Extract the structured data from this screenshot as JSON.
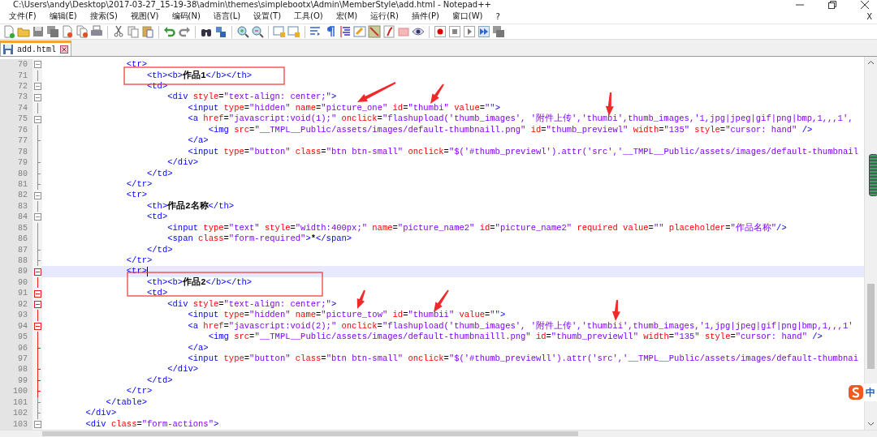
{
  "window": {
    "title": "C:\\Users\\andy\\Desktop\\2017-03-27_15-19-38\\admin\\themes\\simplebootx\\Admin\\MemberStyle\\add.html - Notepad++"
  },
  "menu": [
    "文件(F)",
    "编辑(E)",
    "搜索(S)",
    "视图(V)",
    "编码(N)",
    "语言(L)",
    "设置(T)",
    "工具(O)",
    "宏(M)",
    "运行(R)",
    "插件(P)",
    "窗口(W)",
    "?"
  ],
  "close_document": "X",
  "tabs": [
    {
      "label": "add.html",
      "selected": true
    }
  ],
  "lines": [
    {
      "number": "70",
      "kind": "fold-start",
      "fold_active": false,
      "current": false,
      "tokens": [
        {
          "kind": "tag",
          "text": "                <tr>"
        }
      ]
    },
    {
      "number": "71",
      "kind": "fold-body",
      "fold_active": false,
      "current": false,
      "tokens": [
        {
          "kind": "tag",
          "text": "                    <th><b>"
        },
        {
          "kind": "text",
          "text": "作品1"
        },
        {
          "kind": "tag",
          "text": "</b></th>"
        }
      ]
    },
    {
      "number": "72",
      "kind": "fold-start",
      "fold_active": false,
      "current": false,
      "tokens": [
        {
          "kind": "tag",
          "text": "                    <td>"
        }
      ]
    },
    {
      "number": "73",
      "kind": "fold-start",
      "fold_active": false,
      "current": false,
      "tokens": [
        {
          "kind": "tag",
          "text": "                        <div"
        },
        {
          "kind": "attr",
          "text": " style"
        },
        {
          "kind": "op",
          "text": "="
        },
        {
          "kind": "str",
          "text": "\"text-align: center;\""
        },
        {
          "kind": "tag",
          "text": ">"
        }
      ]
    },
    {
      "number": "74",
      "kind": "fold-body",
      "fold_active": false,
      "current": false,
      "tokens": [
        {
          "kind": "tag",
          "text": "                            <input"
        },
        {
          "kind": "attr",
          "text": " type"
        },
        {
          "kind": "op",
          "text": "="
        },
        {
          "kind": "str",
          "text": "\"hidden\""
        },
        {
          "kind": "attr",
          "text": " name"
        },
        {
          "kind": "op",
          "text": "="
        },
        {
          "kind": "str",
          "text": "\"picture_one\""
        },
        {
          "kind": "attr",
          "text": " id"
        },
        {
          "kind": "op",
          "text": "="
        },
        {
          "kind": "str",
          "text": "\"thumbi\""
        },
        {
          "kind": "attr",
          "text": " value"
        },
        {
          "kind": "op",
          "text": "="
        },
        {
          "kind": "str",
          "text": "\"\""
        },
        {
          "kind": "tag",
          "text": ">"
        }
      ]
    },
    {
      "number": "75",
      "kind": "fold-start",
      "fold_active": false,
      "current": false,
      "tokens": [
        {
          "kind": "tag",
          "text": "                            <a"
        },
        {
          "kind": "attr",
          "text": " href"
        },
        {
          "kind": "op",
          "text": "="
        },
        {
          "kind": "str",
          "text": "\"javascript:void(1);\""
        },
        {
          "kind": "attr",
          "text": " onclick"
        },
        {
          "kind": "op",
          "text": "="
        },
        {
          "kind": "str",
          "text": "\"flashupload('thumb_images', '附件上传','thumbi',thumb_images,'1,jpg|jpeg|gif|png|bmp,1,,,1',"
        }
      ]
    },
    {
      "number": "76",
      "kind": "fold-body",
      "fold_active": false,
      "current": false,
      "tokens": [
        {
          "kind": "tag",
          "text": "                                <img"
        },
        {
          "kind": "attr",
          "text": " src"
        },
        {
          "kind": "op",
          "text": "="
        },
        {
          "kind": "str",
          "text": "\"__TMPL__Public/assets/images/default-thumbnaill.png\""
        },
        {
          "kind": "attr",
          "text": " id"
        },
        {
          "kind": "op",
          "text": "="
        },
        {
          "kind": "str",
          "text": "\"thumb_previewl\""
        },
        {
          "kind": "attr",
          "text": " width"
        },
        {
          "kind": "op",
          "text": "="
        },
        {
          "kind": "str",
          "text": "\"135\""
        },
        {
          "kind": "attr",
          "text": " style"
        },
        {
          "kind": "op",
          "text": "="
        },
        {
          "kind": "str",
          "text": "\"cursor: hand\""
        },
        {
          "kind": "tag",
          "text": " />"
        }
      ]
    },
    {
      "number": "77",
      "kind": "fold-end",
      "fold_active": false,
      "current": false,
      "tokens": [
        {
          "kind": "tag",
          "text": "                            </a>"
        }
      ]
    },
    {
      "number": "78",
      "kind": "fold-body",
      "fold_active": false,
      "current": false,
      "tokens": [
        {
          "kind": "tag",
          "text": "                            <input"
        },
        {
          "kind": "attr",
          "text": " type"
        },
        {
          "kind": "op",
          "text": "="
        },
        {
          "kind": "str",
          "text": "\"button\""
        },
        {
          "kind": "attr",
          "text": " class"
        },
        {
          "kind": "op",
          "text": "="
        },
        {
          "kind": "str",
          "text": "\"btn btn-small\""
        },
        {
          "kind": "attr",
          "text": " onclick"
        },
        {
          "kind": "op",
          "text": "="
        },
        {
          "kind": "str",
          "text": "\"$('#thumb_previewl').attr('src','__TMPL__Public/assets/images/default-thumbnail"
        }
      ]
    },
    {
      "number": "79",
      "kind": "fold-end",
      "fold_active": false,
      "current": false,
      "tokens": [
        {
          "kind": "tag",
          "text": "                        </div>"
        }
      ]
    },
    {
      "number": "80",
      "kind": "fold-end",
      "fold_active": false,
      "current": false,
      "tokens": [
        {
          "kind": "tag",
          "text": "                    </td>"
        }
      ]
    },
    {
      "number": "81",
      "kind": "fold-end",
      "fold_active": false,
      "current": false,
      "tokens": [
        {
          "kind": "tag",
          "text": "                </tr>"
        }
      ]
    },
    {
      "number": "82",
      "kind": "fold-start",
      "fold_active": false,
      "current": false,
      "tokens": [
        {
          "kind": "tag",
          "text": "                <tr>"
        }
      ]
    },
    {
      "number": "83",
      "kind": "fold-body",
      "fold_active": false,
      "current": false,
      "tokens": [
        {
          "kind": "tag",
          "text": "                    <th>"
        },
        {
          "kind": "text",
          "text": "作品2名称"
        },
        {
          "kind": "tag",
          "text": "</th>"
        }
      ]
    },
    {
      "number": "84",
      "kind": "fold-start",
      "fold_active": false,
      "current": false,
      "tokens": [
        {
          "kind": "tag",
          "text": "                    <td>"
        }
      ]
    },
    {
      "number": "85",
      "kind": "fold-body",
      "fold_active": false,
      "current": false,
      "tokens": [
        {
          "kind": "tag",
          "text": "                        <input"
        },
        {
          "kind": "attr",
          "text": " type"
        },
        {
          "kind": "op",
          "text": "="
        },
        {
          "kind": "str",
          "text": "\"text\""
        },
        {
          "kind": "attr",
          "text": " style"
        },
        {
          "kind": "op",
          "text": "="
        },
        {
          "kind": "str",
          "text": "\"width:400px;\""
        },
        {
          "kind": "attr",
          "text": " name"
        },
        {
          "kind": "op",
          "text": "="
        },
        {
          "kind": "str",
          "text": "\"picture_name2\""
        },
        {
          "kind": "attr",
          "text": " id"
        },
        {
          "kind": "op",
          "text": "="
        },
        {
          "kind": "str",
          "text": "\"picture_name2\""
        },
        {
          "kind": "attr",
          "text": " required value"
        },
        {
          "kind": "op",
          "text": "="
        },
        {
          "kind": "str",
          "text": "\"\""
        },
        {
          "kind": "attr",
          "text": " placeholder"
        },
        {
          "kind": "op",
          "text": "="
        },
        {
          "kind": "str",
          "text": "\"作品名称\""
        },
        {
          "kind": "tag",
          "text": "/>"
        }
      ]
    },
    {
      "number": "86",
      "kind": "fold-body",
      "fold_active": false,
      "current": false,
      "tokens": [
        {
          "kind": "tag",
          "text": "                        <span"
        },
        {
          "kind": "attr",
          "text": " class"
        },
        {
          "kind": "op",
          "text": "="
        },
        {
          "kind": "str",
          "text": "\"form-required\""
        },
        {
          "kind": "tag",
          "text": ">"
        },
        {
          "kind": "text",
          "text": "*"
        },
        {
          "kind": "tag",
          "text": "</span>"
        }
      ]
    },
    {
      "number": "87",
      "kind": "fold-end",
      "fold_active": false,
      "current": false,
      "tokens": [
        {
          "kind": "tag",
          "text": "                    </td>"
        }
      ]
    },
    {
      "number": "88",
      "kind": "fold-end",
      "fold_active": false,
      "current": false,
      "tokens": [
        {
          "kind": "tag",
          "text": "                </tr>"
        }
      ]
    },
    {
      "number": "89",
      "kind": "fold-start",
      "fold_active": true,
      "current": true,
      "tokens": [
        {
          "kind": "tag",
          "text": "                <tr>"
        }
      ]
    },
    {
      "number": "90",
      "kind": "fold-body",
      "fold_active": true,
      "current": false,
      "tokens": [
        {
          "kind": "tag",
          "text": "                    <th><b>"
        },
        {
          "kind": "text",
          "text": "作品2"
        },
        {
          "kind": "tag",
          "text": "</b></th>"
        }
      ]
    },
    {
      "number": "91",
      "kind": "fold-start",
      "fold_active": true,
      "current": false,
      "tokens": [
        {
          "kind": "tag",
          "text": "                    <td>"
        }
      ]
    },
    {
      "number": "92",
      "kind": "fold-start",
      "fold_active": true,
      "current": false,
      "tokens": [
        {
          "kind": "tag",
          "text": "                        <div"
        },
        {
          "kind": "attr",
          "text": " style"
        },
        {
          "kind": "op",
          "text": "="
        },
        {
          "kind": "str",
          "text": "\"text-align: center;\""
        },
        {
          "kind": "tag",
          "text": ">"
        }
      ]
    },
    {
      "number": "93",
      "kind": "fold-body",
      "fold_active": true,
      "current": false,
      "tokens": [
        {
          "kind": "tag",
          "text": "                            <input"
        },
        {
          "kind": "attr",
          "text": " type"
        },
        {
          "kind": "op",
          "text": "="
        },
        {
          "kind": "str",
          "text": "\"hidden\""
        },
        {
          "kind": "attr",
          "text": " name"
        },
        {
          "kind": "op",
          "text": "="
        },
        {
          "kind": "str",
          "text": "\"picture_tow\""
        },
        {
          "kind": "attr",
          "text": " id"
        },
        {
          "kind": "op",
          "text": "="
        },
        {
          "kind": "str",
          "text": "\"thumbii\""
        },
        {
          "kind": "attr",
          "text": " value"
        },
        {
          "kind": "op",
          "text": "="
        },
        {
          "kind": "str",
          "text": "\"\""
        },
        {
          "kind": "tag",
          "text": ">"
        }
      ]
    },
    {
      "number": "94",
      "kind": "fold-start",
      "fold_active": true,
      "current": false,
      "tokens": [
        {
          "kind": "tag",
          "text": "                            <a"
        },
        {
          "kind": "attr",
          "text": " href"
        },
        {
          "kind": "op",
          "text": "="
        },
        {
          "kind": "str",
          "text": "\"javascript:void(2);\""
        },
        {
          "kind": "attr",
          "text": " onclick"
        },
        {
          "kind": "op",
          "text": "="
        },
        {
          "kind": "str",
          "text": "\"flashupload('thumb_images', '附件上传','thumbii',thumb_images,'1,jpg|jpeg|gif|png|bmp,1,,,1'"
        }
      ]
    },
    {
      "number": "95",
      "kind": "fold-body",
      "fold_active": true,
      "current": false,
      "tokens": [
        {
          "kind": "tag",
          "text": "                                <img"
        },
        {
          "kind": "attr",
          "text": " src"
        },
        {
          "kind": "op",
          "text": "="
        },
        {
          "kind": "str",
          "text": "\"__TMPL__Public/assets/images/default-thumbnailll.png\""
        },
        {
          "kind": "attr",
          "text": " id"
        },
        {
          "kind": "op",
          "text": "="
        },
        {
          "kind": "str",
          "text": "\"thumb_previewll\""
        },
        {
          "kind": "attr",
          "text": " width"
        },
        {
          "kind": "op",
          "text": "="
        },
        {
          "kind": "str",
          "text": "\"135\""
        },
        {
          "kind": "attr",
          "text": " style"
        },
        {
          "kind": "op",
          "text": "="
        },
        {
          "kind": "str",
          "text": "\"cursor: hand\""
        },
        {
          "kind": "tag",
          "text": " />"
        }
      ]
    },
    {
      "number": "96",
      "kind": "fold-end",
      "fold_active": true,
      "current": false,
      "tokens": [
        {
          "kind": "tag",
          "text": "                            </a>"
        }
      ]
    },
    {
      "number": "97",
      "kind": "fold-body",
      "fold_active": true,
      "current": false,
      "tokens": [
        {
          "kind": "tag",
          "text": "                            <input"
        },
        {
          "kind": "attr",
          "text": " type"
        },
        {
          "kind": "op",
          "text": "="
        },
        {
          "kind": "str",
          "text": "\"button\""
        },
        {
          "kind": "attr",
          "text": " class"
        },
        {
          "kind": "op",
          "text": "="
        },
        {
          "kind": "str",
          "text": "\"btn btn-small\""
        },
        {
          "kind": "attr",
          "text": " onclick"
        },
        {
          "kind": "op",
          "text": "="
        },
        {
          "kind": "str",
          "text": "\"$('#thumb_previewll').attr('src','__TMPL__Public/assets/images/default-thumbnai"
        }
      ]
    },
    {
      "number": "98",
      "kind": "fold-end",
      "fold_active": true,
      "current": false,
      "tokens": [
        {
          "kind": "tag",
          "text": "                        </div>"
        }
      ]
    },
    {
      "number": "99",
      "kind": "fold-end",
      "fold_active": true,
      "current": false,
      "tokens": [
        {
          "kind": "tag",
          "text": "                    </td>"
        }
      ]
    },
    {
      "number": "100",
      "kind": "fold-end",
      "fold_active": true,
      "current": false,
      "tokens": [
        {
          "kind": "tag",
          "text": "                </tr>"
        }
      ]
    },
    {
      "number": "101",
      "kind": "fold-end",
      "fold_active": false,
      "current": false,
      "tokens": [
        {
          "kind": "tag",
          "text": "            </table>"
        }
      ]
    },
    {
      "number": "102",
      "kind": "fold-end",
      "fold_active": false,
      "current": false,
      "tokens": [
        {
          "kind": "tag",
          "text": "        </div>"
        }
      ]
    },
    {
      "number": "103",
      "kind": "fold-start",
      "fold_active": false,
      "current": false,
      "tokens": [
        {
          "kind": "tag",
          "text": "        <div"
        },
        {
          "kind": "attr",
          "text": " class"
        },
        {
          "kind": "op",
          "text": "="
        },
        {
          "kind": "str",
          "text": "\"form-actions\""
        },
        {
          "kind": "tag",
          "text": ">"
        }
      ]
    }
  ],
  "ime": {
    "label": "中"
  }
}
